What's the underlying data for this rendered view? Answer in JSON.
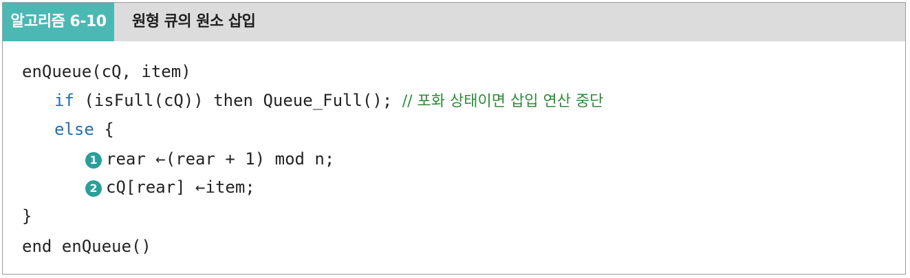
{
  "header": {
    "tag": "알고리즘 6-10",
    "title": "원형 큐의 원소 삽입"
  },
  "code": {
    "line1": "enQueue(cQ, item)",
    "line2_kw": "if",
    "line2_body": " (isFull(cQ)) then Queue_Full(); ",
    "line2_comment": "// 포화 상태이면 삽입 연산 중단",
    "line3_kw": "else",
    "line3_body": " {",
    "line4_marker": "1",
    "line4_body": "rear ←(rear + 1) mod n;",
    "line5_marker": "2",
    "line5_body": "cQ[rear] ←item;",
    "line6": "}",
    "line7": "end enQueue()"
  },
  "colors": {
    "tag_bg": "#4bb8b4",
    "header_bg": "#dcdcdc",
    "keyword": "#1f6fb6",
    "comment": "#2e8a38",
    "marker_bg": "#2a9f9a"
  }
}
